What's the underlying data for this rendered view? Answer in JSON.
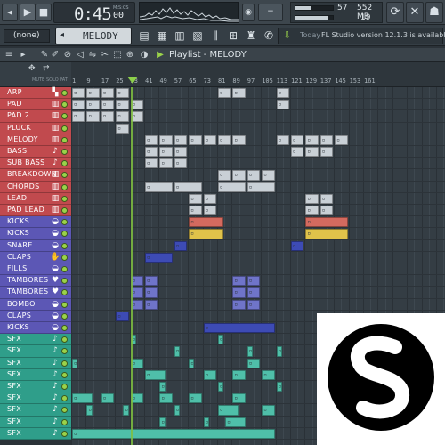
{
  "toolbar": {
    "time": "0:45",
    "time_centis": "00",
    "time_unit": "M:S:CS",
    "cpu": "57",
    "memory": "552 MB",
    "polyphony": "19",
    "cpu_fill": 0.4,
    "mem_fill": 0.85
  },
  "row2": {
    "none_label": "(none)",
    "pattern_name": "MELODY",
    "news_day": "Today",
    "news_text": "FL Studio version 12.1.3 is available!"
  },
  "playlist": {
    "title": "Playlist - MELODY",
    "ruler": [
      "1",
      "9",
      "17",
      "25",
      "33",
      "41",
      "49",
      "57",
      "65",
      "73",
      "81",
      "89",
      "97",
      "105",
      "113",
      "121",
      "129",
      "137",
      "145",
      "153",
      "161"
    ],
    "tool_labels": [
      "MUTE",
      "SOLO",
      "PAT"
    ]
  },
  "tracks": [
    {
      "name": "ARP",
      "color": "#c14a4e",
      "icon": "piano-roll-icon",
      "icon_char": "▚"
    },
    {
      "name": "PAD",
      "color": "#c14a4e",
      "icon": "piano-roll-icon",
      "icon_char": "▥"
    },
    {
      "name": "PAD 2",
      "color": "#c14a4e",
      "icon": "piano-roll-icon",
      "icon_char": "▥"
    },
    {
      "name": "PLUCK",
      "color": "#c14a4e",
      "icon": "piano-roll-icon",
      "icon_char": "▥"
    },
    {
      "name": "MELODY",
      "color": "#c14a4e",
      "icon": "piano-roll-icon",
      "icon_char": "▥"
    },
    {
      "name": "BASS",
      "color": "#c14a4e",
      "icon": "guitar-icon",
      "icon_char": "♪"
    },
    {
      "name": "SUB BASS",
      "color": "#c14a4e",
      "icon": "guitar-icon",
      "icon_char": "♪"
    },
    {
      "name": "BREAKDOWN",
      "color": "#c14a4e",
      "icon": "piano-roll-icon",
      "icon_char": "▥"
    },
    {
      "name": "CHORDS",
      "color": "#c14a4e",
      "icon": "piano-roll-icon",
      "icon_char": "▥"
    },
    {
      "name": "LEAD",
      "color": "#c14a4e",
      "icon": "piano-roll-icon",
      "icon_char": "▥"
    },
    {
      "name": "PAD LEAD",
      "color": "#c14a4e",
      "icon": "piano-roll-icon",
      "icon_char": "▥"
    },
    {
      "name": "KICKS",
      "color": "#5c57b5",
      "icon": "drum-icon",
      "icon_char": "◒"
    },
    {
      "name": "KICKS",
      "color": "#5c57b5",
      "icon": "drum-icon",
      "icon_char": "◒"
    },
    {
      "name": "SNARE",
      "color": "#5c57b5",
      "icon": "drum-icon",
      "icon_char": "◒"
    },
    {
      "name": "CLAPS",
      "color": "#5c57b5",
      "icon": "hand-icon",
      "icon_char": "✋"
    },
    {
      "name": "FILLS",
      "color": "#5c57b5",
      "icon": "drum-icon",
      "icon_char": "◒"
    },
    {
      "name": "TAMBORES",
      "color": "#5c57b5",
      "icon": "heart-icon",
      "icon_char": "♥"
    },
    {
      "name": "TAMBORES",
      "color": "#5c57b5",
      "icon": "heart-icon",
      "icon_char": "♥"
    },
    {
      "name": "BOMBO",
      "color": "#5c57b5",
      "icon": "drum-icon",
      "icon_char": "◒"
    },
    {
      "name": "CLAPS",
      "color": "#5c57b5",
      "icon": "drum-icon",
      "icon_char": "◒"
    },
    {
      "name": "KICKS",
      "color": "#5c57b5",
      "icon": "drum-icon",
      "icon_char": "◒"
    },
    {
      "name": "SFX",
      "color": "#2f9e8a",
      "icon": "note-icon",
      "icon_char": "♪"
    },
    {
      "name": "SFX",
      "color": "#2f9e8a",
      "icon": "note-icon",
      "icon_char": "♪"
    },
    {
      "name": "SFX",
      "color": "#2f9e8a",
      "icon": "note-icon",
      "icon_char": "♪"
    },
    {
      "name": "SFX",
      "color": "#2f9e8a",
      "icon": "note-icon",
      "icon_char": "♪"
    },
    {
      "name": "SFX",
      "color": "#2f9e8a",
      "icon": "note-icon",
      "icon_char": "♪"
    },
    {
      "name": "SFX",
      "color": "#2f9e8a",
      "icon": "note-icon",
      "icon_char": "♪"
    },
    {
      "name": "SFX",
      "color": "#2f9e8a",
      "icon": "note-icon",
      "icon_char": "♪"
    },
    {
      "name": "SFX",
      "color": "#2f9e8a",
      "icon": "note-icon",
      "icon_char": "♪"
    },
    {
      "name": "SFX",
      "color": "#2f9e8a",
      "icon": "note-icon",
      "icon_char": "♪"
    }
  ],
  "clips": [
    {
      "track": 0,
      "bars": [
        [
          1,
          9
        ],
        [
          9,
          17
        ],
        [
          17,
          25
        ],
        [
          25,
          33
        ],
        [
          81,
          89
        ],
        [
          89,
          97
        ],
        [
          113,
          121
        ]
      ],
      "color": "#c9d0d6"
    },
    {
      "track": 1,
      "bars": [
        [
          1,
          9
        ],
        [
          9,
          17
        ],
        [
          17,
          25
        ],
        [
          25,
          33
        ],
        [
          33,
          41
        ],
        [
          113,
          121
        ]
      ],
      "color": "#c9d0d6"
    },
    {
      "track": 2,
      "bars": [
        [
          1,
          9
        ],
        [
          9,
          17
        ],
        [
          17,
          25
        ],
        [
          25,
          33
        ],
        [
          33,
          41
        ]
      ],
      "color": "#c9d0d6"
    },
    {
      "track": 3,
      "bars": [
        [
          25,
          33
        ]
      ],
      "color": "#c9d0d6"
    },
    {
      "track": 4,
      "bars": [
        [
          41,
          49
        ],
        [
          49,
          57
        ],
        [
          57,
          65
        ],
        [
          65,
          73
        ],
        [
          73,
          81
        ],
        [
          81,
          89
        ],
        [
          89,
          97
        ],
        [
          113,
          121
        ],
        [
          121,
          129
        ],
        [
          129,
          137
        ],
        [
          137,
          145
        ],
        [
          145,
          153
        ]
      ],
      "color": "#c9d0d6"
    },
    {
      "track": 5,
      "bars": [
        [
          41,
          49
        ],
        [
          49,
          57
        ],
        [
          57,
          65
        ],
        [
          121,
          129
        ],
        [
          129,
          137
        ],
        [
          137,
          145
        ]
      ],
      "color": "#c9d0d6"
    },
    {
      "track": 6,
      "bars": [
        [
          41,
          49
        ],
        [
          49,
          57
        ],
        [
          57,
          65
        ]
      ],
      "color": "#c9d0d6"
    },
    {
      "track": 7,
      "bars": [
        [
          81,
          89
        ],
        [
          89,
          97
        ],
        [
          97,
          105
        ],
        [
          105,
          113
        ]
      ],
      "color": "#c9d0d6"
    },
    {
      "track": 8,
      "bars": [
        [
          41,
          57
        ],
        [
          57,
          73
        ],
        [
          81,
          97
        ],
        [
          97,
          113
        ]
      ],
      "color": "#c9d0d6"
    },
    {
      "track": 9,
      "bars": [
        [
          65,
          73
        ],
        [
          73,
          81
        ],
        [
          129,
          137
        ],
        [
          137,
          145
        ]
      ],
      "color": "#c9d0d6"
    },
    {
      "track": 10,
      "bars": [
        [
          65,
          73
        ],
        [
          73,
          81
        ],
        [
          129,
          137
        ],
        [
          137,
          145
        ]
      ],
      "color": "#c9d0d6"
    },
    {
      "track": 11,
      "bars": [
        [
          65,
          85
        ],
        [
          129,
          153
        ]
      ],
      "color": "#d46a5f"
    },
    {
      "track": 12,
      "bars": [
        [
          65,
          85
        ],
        [
          129,
          153
        ]
      ],
      "color": "#e0c24a"
    },
    {
      "track": 13,
      "bars": [
        [
          57,
          65
        ],
        [
          121,
          129
        ]
      ],
      "color": "#3d4bb5"
    },
    {
      "track": 14,
      "bars": [
        [
          41,
          57
        ]
      ],
      "color": "#3d4bb5"
    },
    {
      "track": 16,
      "bars": [
        [
          33,
          41
        ],
        [
          41,
          49
        ],
        [
          89,
          97
        ],
        [
          97,
          105
        ]
      ],
      "color": "#6f74c9"
    },
    {
      "track": 17,
      "bars": [
        [
          33,
          41
        ],
        [
          41,
          49
        ],
        [
          89,
          97
        ],
        [
          97,
          105
        ]
      ],
      "color": "#6f74c9"
    },
    {
      "track": 18,
      "bars": [
        [
          33,
          41
        ],
        [
          41,
          49
        ],
        [
          89,
          97
        ],
        [
          97,
          105
        ]
      ],
      "color": "#6f74c9"
    },
    {
      "track": 19,
      "bars": [
        [
          25,
          33
        ]
      ],
      "color": "#3d4bb5"
    },
    {
      "track": 20,
      "bars": [
        [
          73,
          113
        ]
      ],
      "color": "#3d4bb5"
    },
    {
      "track": 21,
      "bars": [
        [
          33,
          37
        ],
        [
          81,
          85
        ]
      ],
      "color": "#4fbfa9"
    },
    {
      "track": 22,
      "bars": [
        [
          57,
          61
        ],
        [
          97,
          101
        ],
        [
          113,
          117
        ]
      ],
      "color": "#4fbfa9"
    },
    {
      "track": 23,
      "bars": [
        [
          1,
          5
        ],
        [
          33,
          41
        ],
        [
          65,
          69
        ],
        [
          97,
          105
        ]
      ],
      "color": "#4fbfa9"
    },
    {
      "track": 24,
      "bars": [
        [
          41,
          53
        ],
        [
          73,
          81
        ],
        [
          89,
          97
        ],
        [
          105,
          113
        ]
      ],
      "color": "#4fbfa9"
    },
    {
      "track": 25,
      "bars": [
        [
          49,
          53
        ],
        [
          81,
          85
        ],
        [
          113,
          117
        ]
      ],
      "color": "#4fbfa9"
    },
    {
      "track": 26,
      "bars": [
        [
          1,
          13
        ],
        [
          17,
          25
        ],
        [
          33,
          41
        ],
        [
          49,
          57
        ],
        [
          65,
          73
        ],
        [
          89,
          97
        ]
      ],
      "color": "#4fbfa9"
    },
    {
      "track": 27,
      "bars": [
        [
          9,
          13
        ],
        [
          29,
          33
        ],
        [
          57,
          61
        ],
        [
          81,
          93
        ],
        [
          105,
          113
        ]
      ],
      "color": "#4fbfa9"
    },
    {
      "track": 28,
      "bars": [
        [
          49,
          53
        ],
        [
          73,
          77
        ],
        [
          85,
          97
        ]
      ],
      "color": "#4fbfa9"
    },
    {
      "track": 29,
      "bars": [
        [
          1,
          113
        ]
      ],
      "color": "#4fbfa9"
    }
  ],
  "logo": {
    "name": "spinnin-records-logo",
    "letter": "S"
  }
}
